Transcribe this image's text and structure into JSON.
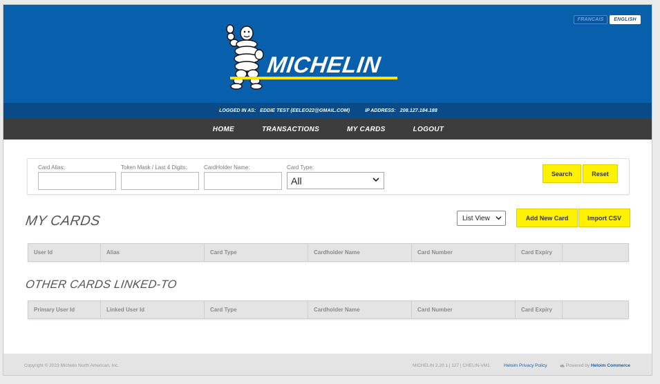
{
  "header": {
    "brand": "MICHELIN",
    "lang_fr": "FRANCAIS",
    "lang_en": "ENGLISH",
    "logged_in_label": "LOGGED IN AS:",
    "logged_in_value": "EDDIE TEST (EELEO22@GMAIL.COM)",
    "ip_label": "IP ADDRESS:",
    "ip_value": "208.127.184.188",
    "colors": {
      "blue": "#0860ad",
      "dark_blue": "#0a4a86",
      "nav": "#3d3d3d",
      "yellow": "#fce500"
    }
  },
  "nav": {
    "items": [
      {
        "label": "HOME"
      },
      {
        "label": "TRANSACTIONS"
      },
      {
        "label": "MY CARDS"
      },
      {
        "label": "LOGOUT"
      }
    ]
  },
  "filter": {
    "card_alias_label": "Card Alias:",
    "card_alias_value": "",
    "token_mask_label": "Token Mask / Last 4 Digits:",
    "token_mask_value": "",
    "cardholder_label": "CardHolder Name:",
    "cardholder_value": "",
    "card_type_label": "Card Type:",
    "card_type_value": "All",
    "search_label": "Search",
    "reset_label": "Reset"
  },
  "my_cards": {
    "title": "MY CARDS",
    "view_select_value": "List View",
    "add_new_label": "Add New Card",
    "import_label": "Import CSV",
    "columns": [
      {
        "label": "User Id"
      },
      {
        "label": "Alias"
      },
      {
        "label": "Card Type"
      },
      {
        "label": "Cardholder Name"
      },
      {
        "label": "Card Number"
      },
      {
        "label": "Card Expiry"
      },
      {
        "label": ""
      }
    ]
  },
  "other_cards": {
    "title": "OTHER CARDS LINKED-TO",
    "columns": [
      {
        "label": "Primary User Id"
      },
      {
        "label": "Linked User Id"
      },
      {
        "label": "Card Type"
      },
      {
        "label": "Cardholder Name"
      },
      {
        "label": "Card Number"
      },
      {
        "label": "Card Expiry"
      },
      {
        "label": ""
      }
    ]
  },
  "footer": {
    "copyright": "Copyright © 2023 Michelin North American, Inc.",
    "version": "MICHELIN 2.20.1 | 127 | CHELIN-VM1",
    "privacy": "Heloim Privacy Policy",
    "powered_prefix": "Powered by",
    "powered_brand": "Heloim Commerce"
  }
}
